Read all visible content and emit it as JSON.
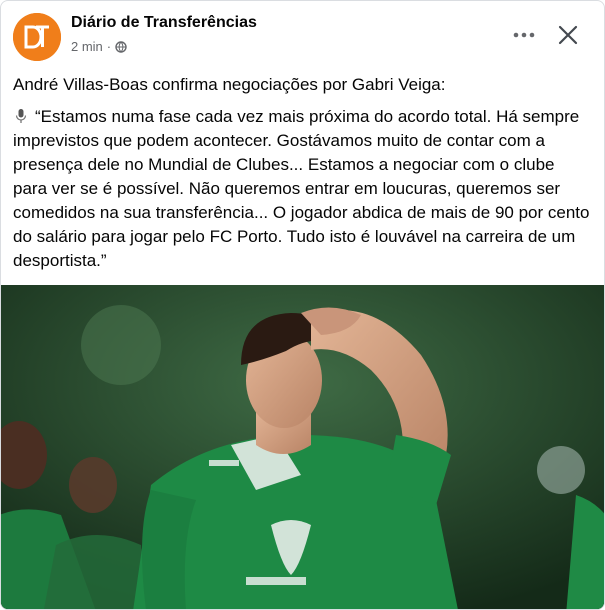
{
  "post": {
    "page_name": "Diário de Transferências",
    "timestamp": "2 min",
    "separator": "·",
    "avatar_icon": "dt-logo",
    "avatar_color": "#f07e1a",
    "headline": "André Villas-Boas confirma negociações por Gabri Veiga:",
    "quote": "“Estamos numa fase cada vez mais próxima do acordo total. Há sempre imprevistos que podem acontecer. Gostávamos muito de contar com a presença dele no Mundial de Clubes... Estamos a negociar com o clube para ver se é possível. Não queremos entrar em loucuras, queremos ser comedidos na sua transferência... O jogador abdica de mais de 90 por cento do salário para jogar pelo FC Porto. Tudo isto é louvável na carreira de um desportista.”"
  },
  "icons": {
    "more": "more-options-icon",
    "close": "close-icon",
    "privacy": "globe-icon",
    "quote_prefix": "microphone-icon"
  },
  "photo": {
    "jersey_color": "#1e8a45",
    "background_color": "#1f3d24"
  }
}
